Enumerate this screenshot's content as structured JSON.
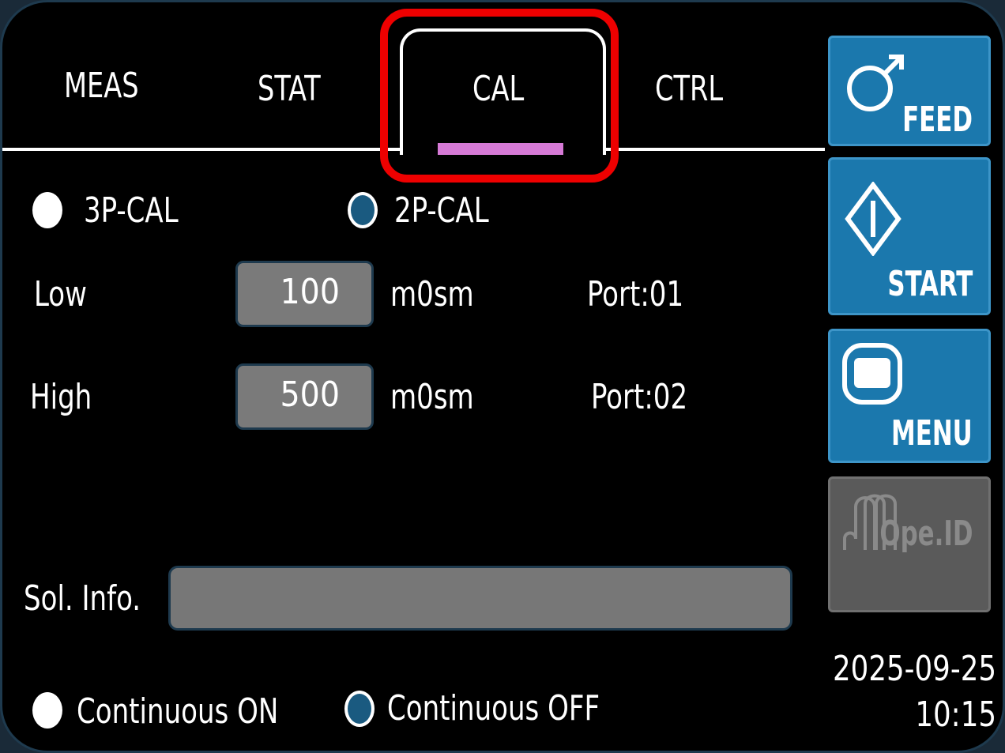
{
  "tabs": {
    "meas": "MEAS",
    "stat": "STAT",
    "cal": "CAL",
    "ctrl": "CTRL",
    "active": "CAL"
  },
  "calibration_mode": {
    "options": [
      {
        "label": "3P-CAL",
        "selected": false
      },
      {
        "label": "2P-CAL",
        "selected": true
      }
    ]
  },
  "points": {
    "low": {
      "label": "Low",
      "value": "100",
      "unit": "m0sm",
      "port": "Port:01"
    },
    "high": {
      "label": "High",
      "value": "500",
      "unit": "m0sm",
      "port": "Port:02"
    }
  },
  "sol_info": {
    "label": "Sol. Info.",
    "value": ""
  },
  "continuous": {
    "options": [
      {
        "label": "Continuous ON",
        "selected": false
      },
      {
        "label": "Continuous OFF",
        "selected": true
      }
    ]
  },
  "side_buttons": {
    "feed": {
      "label": "FEED",
      "icon": "feed-icon"
    },
    "start": {
      "label": "START",
      "icon": "start-icon"
    },
    "menu": {
      "label": "MENU",
      "icon": "menu-icon"
    },
    "ope_id": {
      "label": "Ope.ID",
      "icon": "operator-id-icon",
      "enabled": false
    }
  },
  "datetime": {
    "date": "2025-09-25",
    "time": "10:15"
  },
  "colors": {
    "background": "#000000",
    "button_blue": "#1b78ad",
    "button_disabled": "#5a5a5a",
    "tab_indicator": "#d67ad6",
    "highlight": "#ee0000",
    "radio_selected": "#1a5a80",
    "field_gray": "#7a7a7a"
  }
}
